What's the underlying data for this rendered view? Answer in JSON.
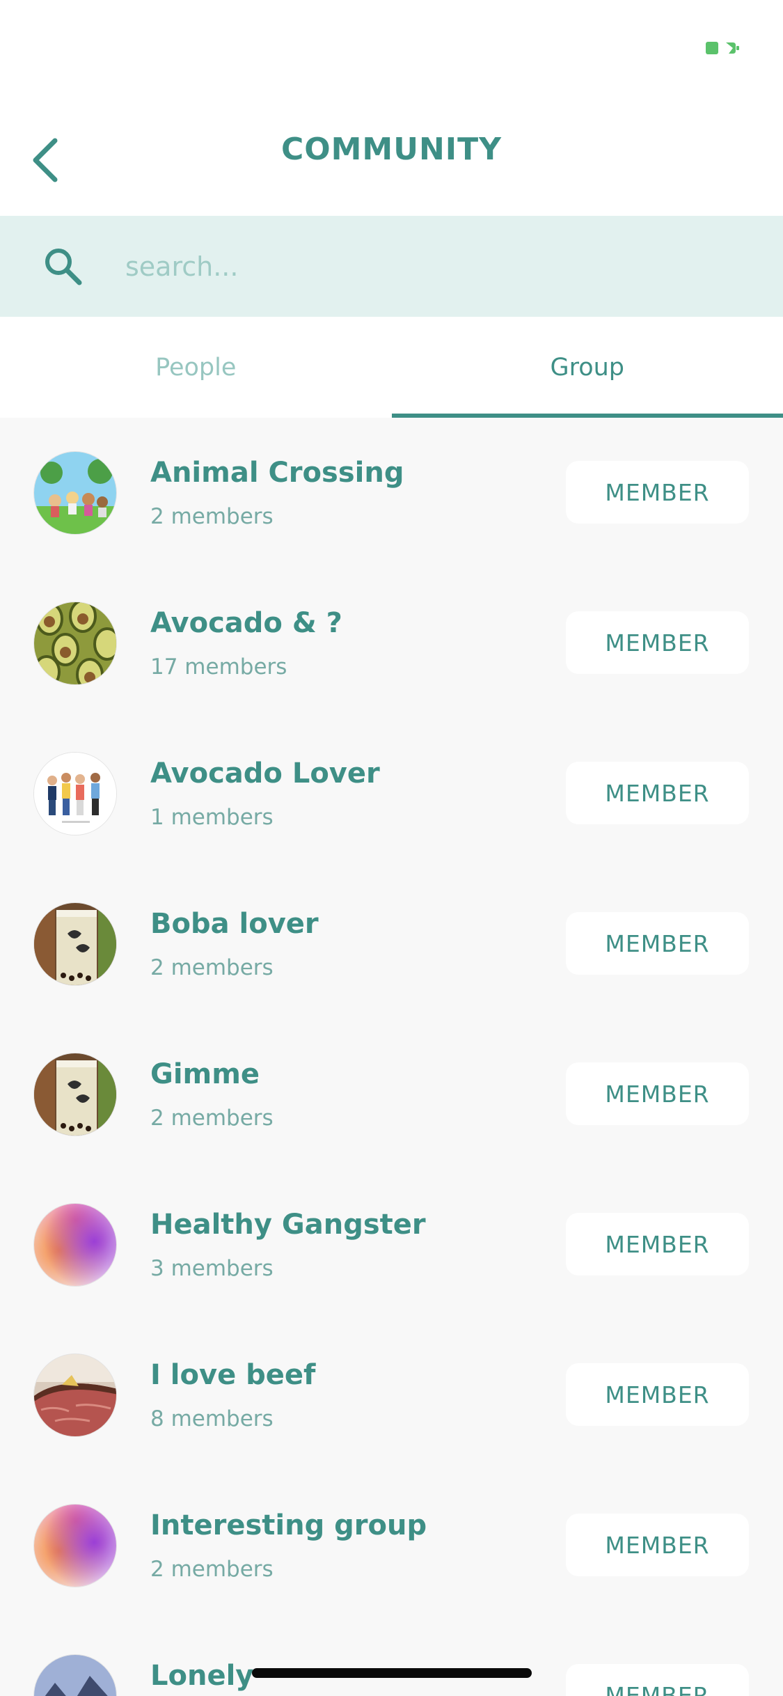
{
  "header": {
    "title": "COMMUNITY",
    "back_icon": "chevron-left-icon"
  },
  "status_bar": {
    "battery_icon": "battery-icon",
    "battery_color": "#5bc26b"
  },
  "search": {
    "icon": "search-icon",
    "placeholder": "search...",
    "value": ""
  },
  "tabs": [
    {
      "label": "People",
      "active": false
    },
    {
      "label": "Group",
      "active": true
    }
  ],
  "colors": {
    "accent": "#3e8f86",
    "search_bg": "#e2f1ef",
    "list_bg": "#f8f8f8"
  },
  "groups": [
    {
      "name": "Animal Crossing",
      "members": "2 members",
      "button": "MEMBER",
      "avatar": "animal-crossing-avatar"
    },
    {
      "name": "Avocado & ?",
      "members": "17 members",
      "button": "MEMBER",
      "avatar": "avocado-avatar"
    },
    {
      "name": "Avocado Lover",
      "members": "1 members",
      "button": "MEMBER",
      "avatar": "people-group-avatar"
    },
    {
      "name": "Boba lover",
      "members": "2 members",
      "button": "MEMBER",
      "avatar": "boba-avatar"
    },
    {
      "name": "Gimme",
      "members": "2 members",
      "button": "MEMBER",
      "avatar": "boba-avatar"
    },
    {
      "name": "Healthy Gangster",
      "members": "3 members",
      "button": "MEMBER",
      "avatar": "watercolor-avatar"
    },
    {
      "name": "I love beef",
      "members": "8 members",
      "button": "MEMBER",
      "avatar": "beef-avatar"
    },
    {
      "name": "Interesting group",
      "members": "2 members",
      "button": "MEMBER",
      "avatar": "watercolor-avatar"
    },
    {
      "name": "Lonely",
      "members": "",
      "button": "MEMBER",
      "avatar": "mountain-avatar"
    }
  ]
}
